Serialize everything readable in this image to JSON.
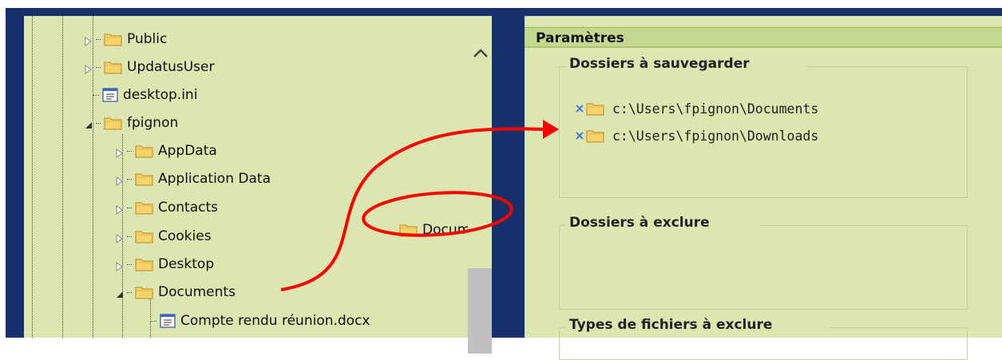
{
  "tree": {
    "items": [
      {
        "label": "Public",
        "type": "folder"
      },
      {
        "label": "UpdatusUser",
        "type": "folder"
      },
      {
        "label": "desktop.ini",
        "type": "file"
      },
      {
        "label": "fpignon",
        "type": "folder"
      },
      {
        "label": "AppData",
        "type": "folder"
      },
      {
        "label": "Application Data",
        "type": "folder"
      },
      {
        "label": "Contacts",
        "type": "folder"
      },
      {
        "label": "Cookies",
        "type": "folder"
      },
      {
        "label": "Desktop",
        "type": "folder"
      },
      {
        "label": "Documents",
        "type": "folder"
      },
      {
        "label": "Compte rendu réunion.docx",
        "type": "file"
      }
    ]
  },
  "drag_ghost": {
    "label": "Documents"
  },
  "panel": {
    "title": "Paramètres",
    "groups": {
      "include": {
        "title": "Dossiers à sauvegarder",
        "paths": [
          "c:\\Users\\fpignon\\Documents",
          "c:\\Users\\fpignon\\Downloads"
        ]
      },
      "exclude": {
        "title": "Dossiers à exclure"
      },
      "filetypes": {
        "title": "Types de fichiers à exclure"
      }
    }
  },
  "colors": {
    "frame": "#15306a",
    "pane_bg": "#dbe6b1",
    "folder_fill": "#f7d36c",
    "remove_icon": "#3a6fd8",
    "annotation": "#ff0000"
  }
}
